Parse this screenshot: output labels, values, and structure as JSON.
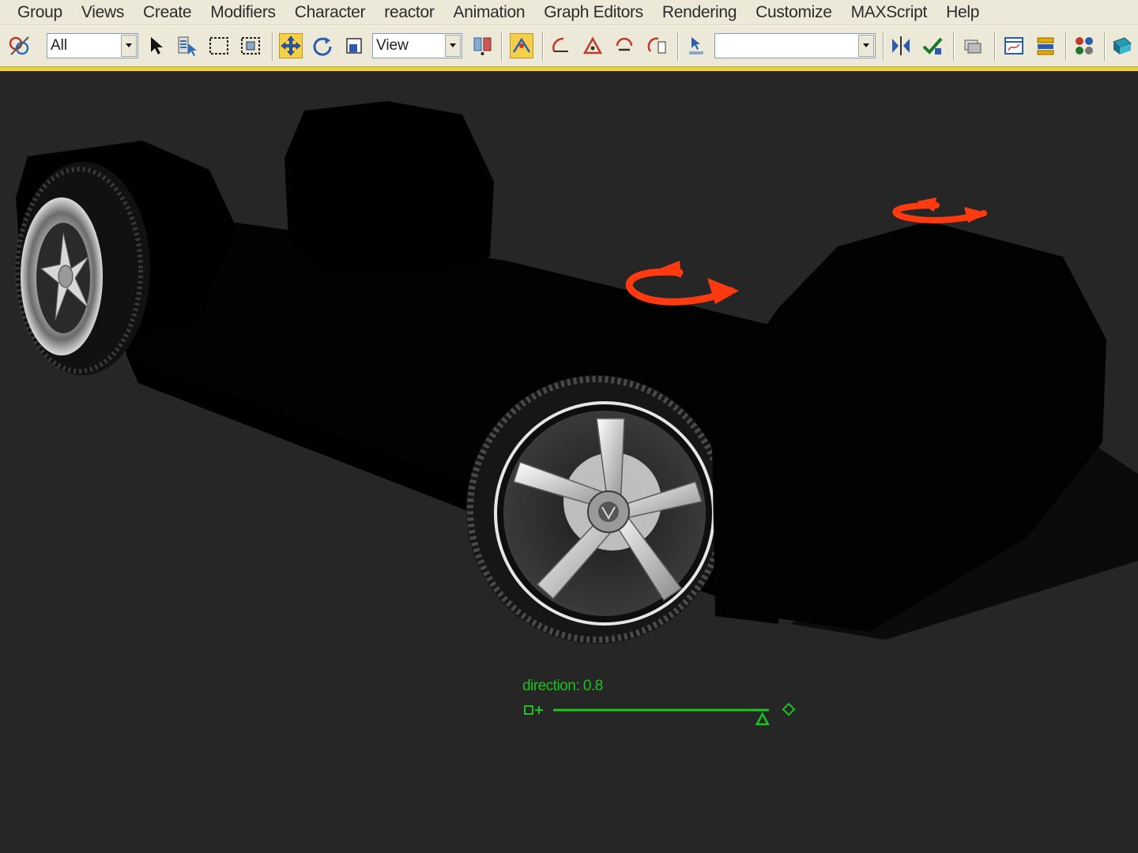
{
  "menu": {
    "items": [
      "Group",
      "Views",
      "Create",
      "Modifiers",
      "Character",
      "reactor",
      "Animation",
      "Graph Editors",
      "Rendering",
      "Customize",
      "MAXScript",
      "Help"
    ]
  },
  "toolbar": {
    "selection_filter": "All",
    "reference_coordinate": "View",
    "named_selection": "",
    "icons": [
      "undo-redo-icon",
      "select-icon",
      "select-by-name-icon",
      "rect-selection-icon",
      "window-crossing-icon",
      "move-icon",
      "rotate-icon",
      "scale-icon",
      "pivot-icon",
      "snap-icon",
      "angle-snap-icon",
      "percent-snap-icon",
      "spinner-snap-icon",
      "edit-named-selection-icon",
      "mirror-icon",
      "align-icon",
      "layer-manager-icon",
      "curve-editor-icon",
      "schematic-icon",
      "material-editor-icon",
      "render-scene-icon"
    ],
    "active_tool": "move"
  },
  "viewport": {
    "manipulator": {
      "label": "direction: 0.8",
      "value": 0.8
    },
    "colors": {
      "background": "#262626",
      "gizmo": "#ff3a10",
      "manipulator": "#19c41b",
      "selection_band": "#e8d23a"
    }
  }
}
